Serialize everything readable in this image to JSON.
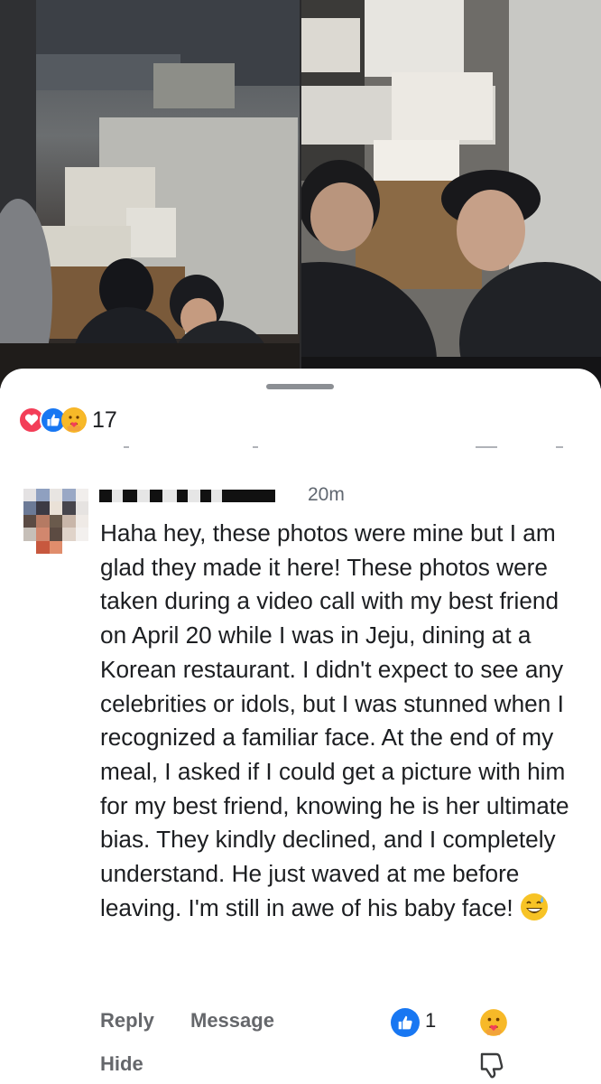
{
  "post": {
    "photos": [
      {
        "name": "left-photo"
      },
      {
        "name": "right-photo"
      }
    ]
  },
  "reactions": {
    "icons": [
      "love-icon",
      "like-icon",
      "care-icon"
    ],
    "count": "17"
  },
  "comment": {
    "author": "",
    "timestamp": "20m",
    "text": "Haha hey, these photos were mine but I am glad they made it here! These photos were taken during a video call with my best friend on April 20 while I was in Jeju, dining at a Korean restaurant. I didn't expect to see any celebrities or idols, but I was stunned when I recognized a familiar face. At the end of my meal, I asked if I could get a picture with him for my best friend, knowing he is her ultimate bias. They kindly declined, and I completely understand. He just waved at me before leaving. I'm still in awe of his baby face!",
    "emoji": "grinning-sweat-emoji",
    "actions": {
      "reply": "Reply",
      "message": "Message",
      "like_count": "1",
      "hide": "Hide"
    }
  },
  "colors": {
    "like_blue": "#1877f2",
    "love_red": "#f33e58",
    "secondary_text": "#65676b",
    "primary_text": "#1c1e21"
  }
}
